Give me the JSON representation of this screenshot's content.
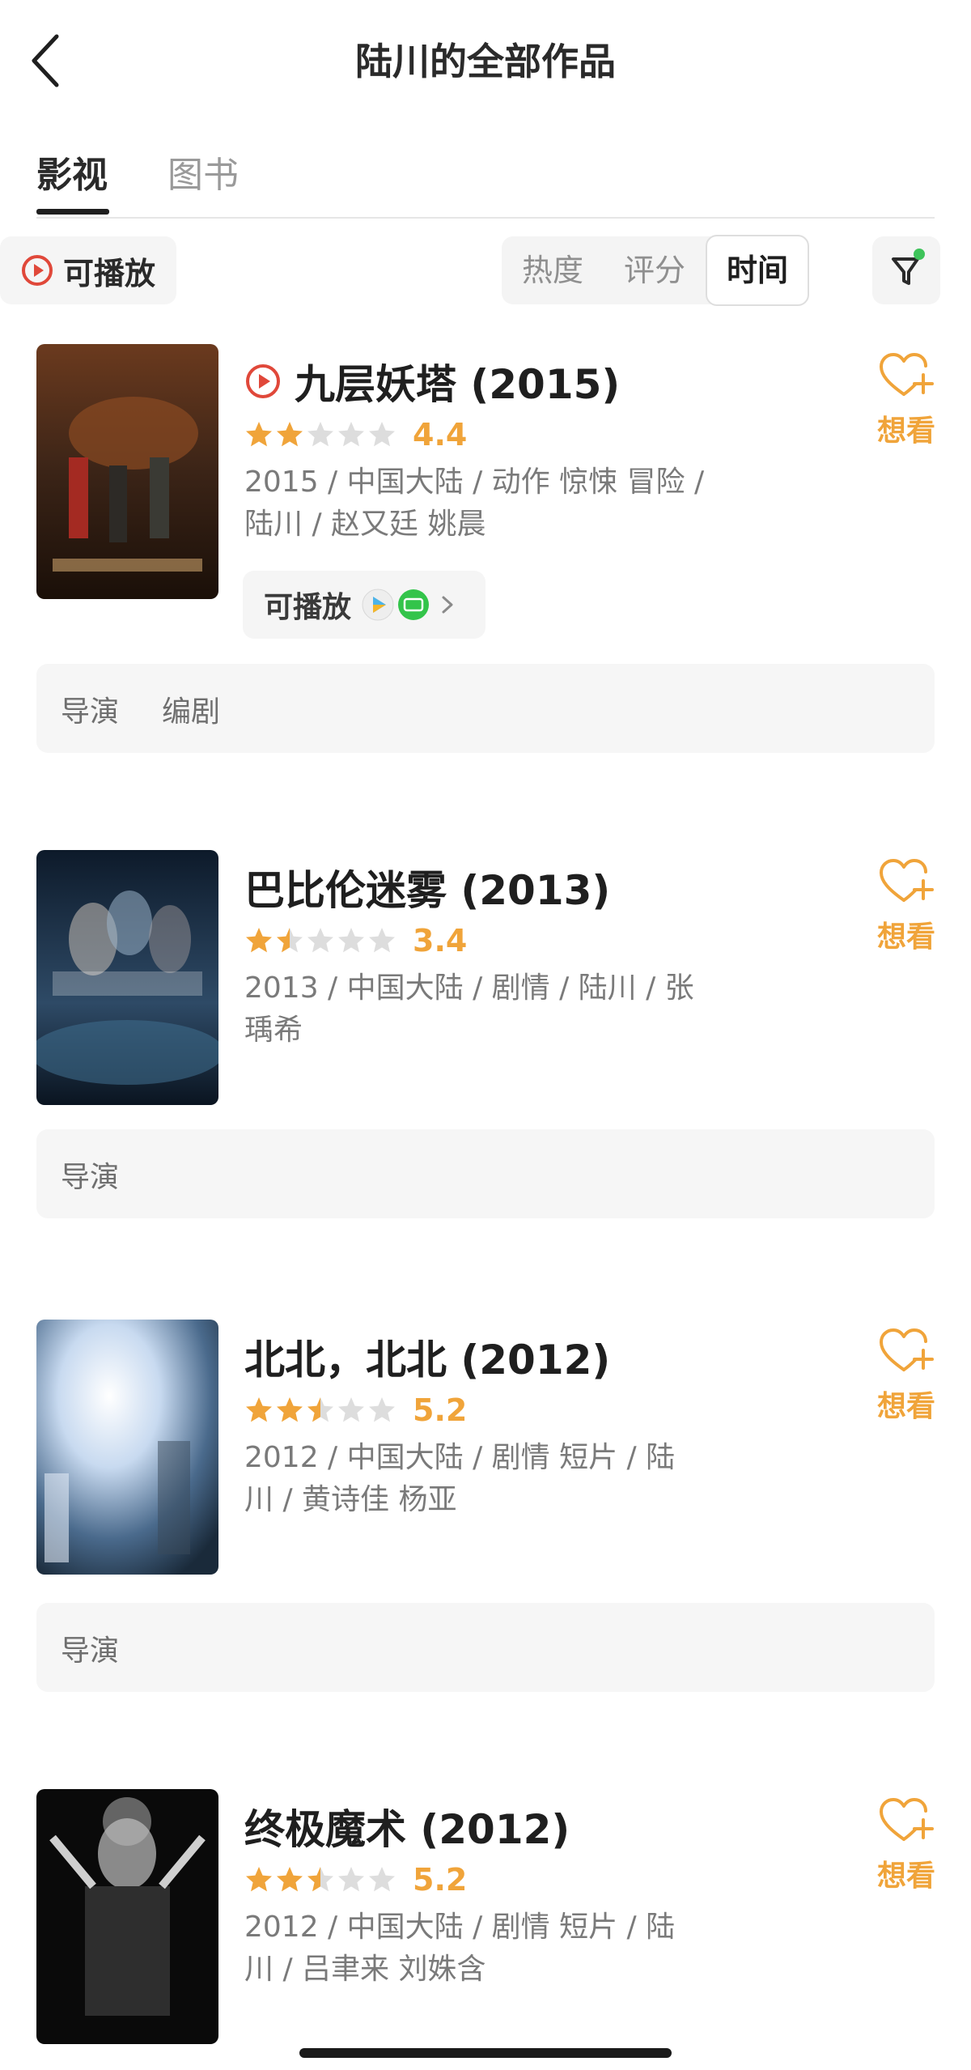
{
  "header": {
    "title": "陆川的全部作品",
    "back_icon": "chevron-left-icon"
  },
  "tabs": [
    {
      "label": "影视",
      "active": true
    },
    {
      "label": "图书",
      "active": false
    }
  ],
  "filters": {
    "playable_label": "可播放",
    "sort_options": [
      {
        "label": "热度",
        "active": false
      },
      {
        "label": "评分",
        "active": false
      },
      {
        "label": "时间",
        "active": true
      }
    ],
    "filter_icon": "funnel-icon",
    "filter_active_dot_color": "#3ec35a"
  },
  "colors": {
    "accent": "#f0a43a",
    "play_red": "#e0483a",
    "star_off": "#dddddd"
  },
  "items": [
    {
      "title": "九层妖塔 (2015)",
      "playable": true,
      "stars": 2,
      "rating": "4.4",
      "meta_line1": "2015 / 中国大陆 / 动作 惊悚 冒险 /",
      "meta_line2": "陆川 / 赵又廷 姚晨",
      "play_label": "可播放",
      "want_label": "想看",
      "roles": [
        "导演",
        "编剧"
      ],
      "poster_colors": [
        "#3b2417",
        "#8a4a22",
        "#c9a06a"
      ]
    },
    {
      "title": "巴比伦迷雾 (2013)",
      "playable": false,
      "stars": 1.5,
      "rating": "3.4",
      "meta_line1": "2013 / 中国大陆 / 剧情 / 陆川 / 张",
      "meta_line2": "瑀希",
      "want_label": "想看",
      "roles": [
        "导演"
      ],
      "poster_colors": [
        "#0d1a2a",
        "#2e4a66",
        "#9ab2c8"
      ]
    },
    {
      "title": "北北，北北 (2012)",
      "playable": false,
      "stars": 2.5,
      "rating": "5.2",
      "meta_line1": "2012 / 中国大陆 / 剧情 短片 / 陆",
      "meta_line2": "川 / 黄诗佳 杨亚",
      "want_label": "想看",
      "roles": [
        "导演"
      ],
      "poster_colors": [
        "#1a2a3a",
        "#7f9fbf",
        "#e8f0fa"
      ]
    },
    {
      "title": "终极魔术 (2012)",
      "playable": false,
      "stars": 2.5,
      "rating": "5.2",
      "meta_line1": "2012 / 中国大陆 / 剧情 短片 / 陆",
      "meta_line2": "川 / 吕聿来 刘姝含",
      "want_label": "想看",
      "roles": [],
      "poster_colors": [
        "#0a0a0a",
        "#3a3a3a",
        "#cfcfcf"
      ]
    }
  ]
}
